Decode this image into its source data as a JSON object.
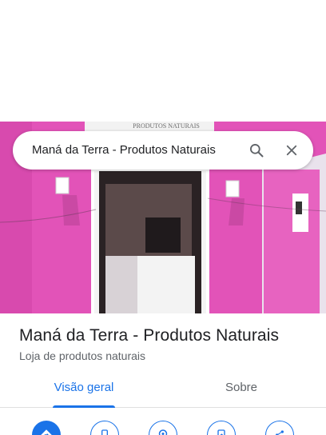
{
  "search": {
    "query": "Maná da Terra - Produtos Naturais",
    "search_icon": "search-icon",
    "close_icon": "close-icon"
  },
  "photo": {
    "sign_text": "PRODUTOS NATURAIS"
  },
  "place": {
    "name": "Maná da Terra - Produtos Naturais",
    "category": "Loja de produtos naturais"
  },
  "tabs": [
    {
      "label": "Visão geral",
      "active": true
    },
    {
      "label": "Sobre",
      "active": false
    }
  ],
  "actions": [
    {
      "icon": "directions-icon"
    },
    {
      "icon": "phone-icon"
    },
    {
      "icon": "nearby-icon"
    },
    {
      "icon": "send-to-phone-icon"
    },
    {
      "icon": "share-icon"
    }
  ],
  "colors": {
    "accent": "#1a73e8",
    "wall": "#e14fb6"
  }
}
